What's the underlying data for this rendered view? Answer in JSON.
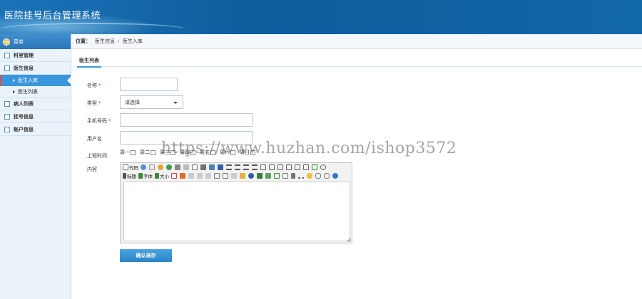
{
  "header": {
    "title": "医院挂号后台管理系统"
  },
  "sidebar": {
    "menu_label": "菜单",
    "items": [
      {
        "label": "科室管理"
      },
      {
        "label": "医生信息",
        "children": [
          {
            "label": "医生入库",
            "active": true
          },
          {
            "label": "医生列表"
          }
        ]
      },
      {
        "label": "病人列表"
      },
      {
        "label": "挂号信息"
      },
      {
        "label": "账户信息"
      }
    ]
  },
  "breadcrumb": {
    "prefix": "位置：",
    "items": [
      "医生信息",
      "医生入库"
    ],
    "separator": "›"
  },
  "tab": {
    "label": "医生列表"
  },
  "form": {
    "name_label": "名称",
    "type_label": "类型",
    "type_selected": "请选择",
    "phone_label": "手机号码",
    "username_label": "用户名",
    "worktime_label": "上班时间",
    "days": [
      "周一",
      "周二",
      "周三",
      "周四",
      "周五",
      "周六",
      "周日"
    ],
    "content_label": "内容",
    "required_mark": "*",
    "save_label": "确认保存"
  },
  "editor": {
    "btn_code": "代码",
    "btn_heading": "标题",
    "btn_font": "字体",
    "btn_size": "大小"
  },
  "watermark": "https://www.huzhan.com/ishop3572",
  "colors": {
    "header": "#1168a9",
    "accent": "#3a96dc",
    "button": "#2b84c7"
  }
}
